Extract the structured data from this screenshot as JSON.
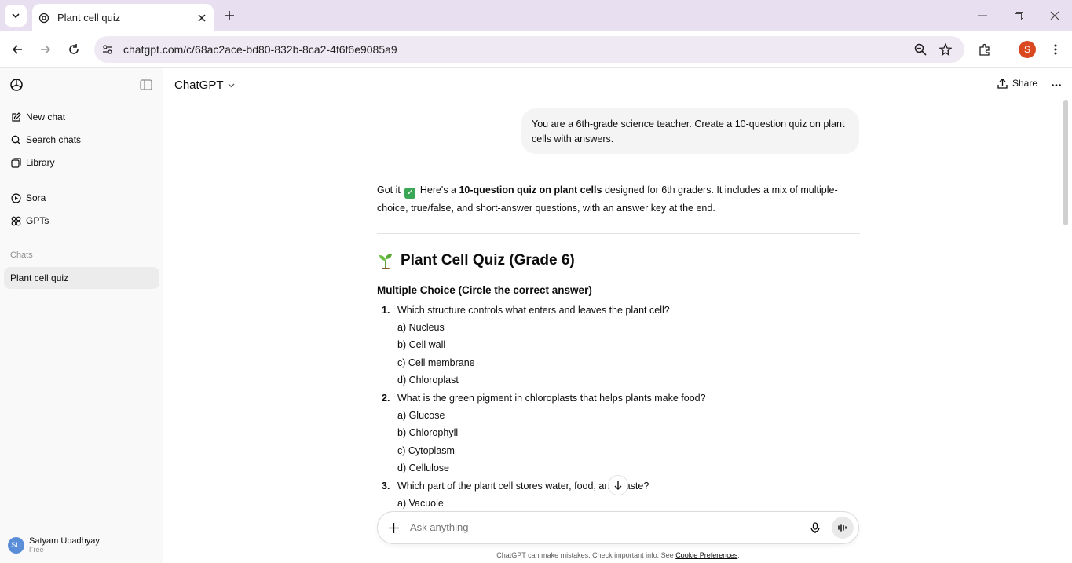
{
  "browser": {
    "tab_title": "Plant cell quiz",
    "url": "chatgpt.com/c/68ac2ace-bd80-832b-8ca2-4f6f6e9085a9",
    "profile_initial": "S"
  },
  "sidebar": {
    "items": [
      {
        "label": "New chat",
        "icon": "pencil-square-icon"
      },
      {
        "label": "Search chats",
        "icon": "search-icon"
      },
      {
        "label": "Library",
        "icon": "library-icon"
      },
      {
        "label": "Sora",
        "icon": "play-circle-icon"
      },
      {
        "label": "GPTs",
        "icon": "grid-icon"
      }
    ],
    "section_label": "Chats",
    "chats": [
      {
        "label": "Plant cell quiz"
      }
    ],
    "user": {
      "initials": "SU",
      "name": "Satyam Upadhyay",
      "plan": "Free"
    }
  },
  "header": {
    "model": "ChatGPT",
    "share_label": "Share"
  },
  "conversation": {
    "user_message": "You are a 6th-grade science teacher. Create a 10-question quiz on plant cells with answers.",
    "intro_prefix": "Got it",
    "intro_mid": "Here's a",
    "intro_bold": "10-question quiz on plant cells",
    "intro_rest": "designed for 6th graders. It includes a mix of multiple-choice, true/false, and short-answer questions, with an answer key at the end.",
    "quiz_title": "Plant Cell Quiz (Grade 6)",
    "section_heading": "Multiple Choice (Circle the correct answer)",
    "questions": [
      {
        "num": "1.",
        "text": "Which structure controls what enters and leaves the plant cell?",
        "options": [
          "a) Nucleus",
          "b) Cell wall",
          "c) Cell membrane",
          "d) Chloroplast"
        ]
      },
      {
        "num": "2.",
        "text": "What is the green pigment in chloroplasts that helps plants make food?",
        "options": [
          "a) Glucose",
          "b) Chlorophyll",
          "c) Cytoplasm",
          "d) Cellulose"
        ]
      },
      {
        "num": "3.",
        "text": "Which part of the plant cell stores water, food, and waste?",
        "options": [
          "a) Vacuole"
        ]
      }
    ]
  },
  "composer": {
    "placeholder": "Ask anything",
    "disclaimer": "ChatGPT can make mistakes. Check important info. See",
    "disclaimer_link": "Cookie Preferences"
  },
  "colors": {
    "tabbar_bg": "#e8e0f0",
    "sidebar_bg": "#f9f9f9",
    "active_chat_bg": "#ececec",
    "user_bubble_bg": "#f4f4f4",
    "profile_avatar": "#d9481f"
  }
}
